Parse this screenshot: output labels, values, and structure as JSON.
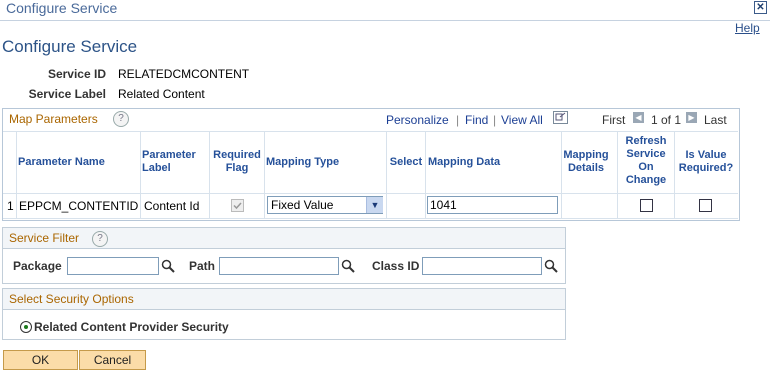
{
  "window": {
    "title": "Configure Service",
    "close_glyph": "✕"
  },
  "help_label": "Help",
  "page_title": "Configure Service",
  "service": {
    "id_label": "Service ID",
    "id_value": "RELATEDCMCONTENT",
    "label_label": "Service Label",
    "label_value": "Related Content"
  },
  "map_parameters": {
    "title": "Map Parameters",
    "help_glyph": "?",
    "personalize": "Personalize",
    "find": "Find",
    "view_all": "View All",
    "sep1": "|",
    "sep2": "|",
    "first": "First",
    "of_text": "1 of 1",
    "last": "Last",
    "columns": {
      "param_name": "Parameter Name",
      "param_label": "Parameter Label",
      "required_flag": "Required Flag",
      "mapping_type": "Mapping Type",
      "select": "Select",
      "mapping_data": "Mapping Data",
      "mapping_details": "Mapping Details",
      "refresh": "Refresh Service On Change",
      "is_value_required": "Is Value Required?"
    },
    "rows": [
      {
        "row_num": "1",
        "param_name": "EPPCM_CONTENTID",
        "param_label": "Content Id",
        "required_flag": true,
        "mapping_type": "Fixed Value",
        "mapping_data": "1041",
        "refresh": false,
        "is_value_required": false
      }
    ]
  },
  "service_filter": {
    "title": "Service Filter",
    "help_glyph": "?",
    "package_label": "Package",
    "package_value": "",
    "path_label": "Path",
    "path_value": "",
    "class_label": "Class ID",
    "class_value": ""
  },
  "security": {
    "title": "Select Security Options",
    "option_label": "Related Content Provider Security",
    "selected": true
  },
  "buttons": {
    "ok": "OK",
    "cancel": "Cancel"
  },
  "colors": {
    "section_title": "#aa6600",
    "link": "#1c3f94",
    "button_bg": "#fbdca8"
  },
  "icons": [
    "close-icon",
    "help-icon",
    "prompt-lookup-icon",
    "dropdown-arrow-icon",
    "checkbox-icon",
    "radio-icon",
    "first-arrow-icon",
    "last-arrow-icon",
    "grid-download-icon"
  ]
}
